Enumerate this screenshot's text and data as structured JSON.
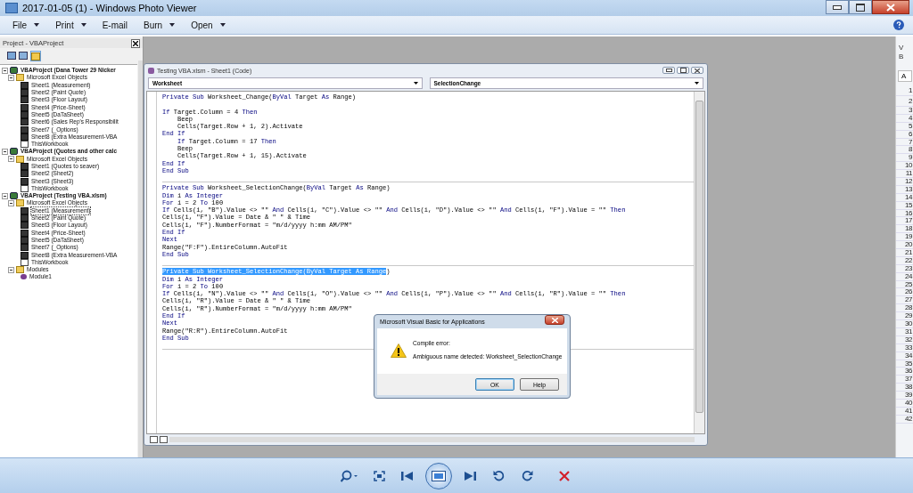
{
  "window": {
    "title": "2017-01-05 (1) - Windows Photo Viewer"
  },
  "menu": [
    {
      "label": "File",
      "dropdown": true
    },
    {
      "label": "Print",
      "dropdown": true
    },
    {
      "label": "E-mail",
      "dropdown": false
    },
    {
      "label": "Burn",
      "dropdown": true
    },
    {
      "label": "Open",
      "dropdown": true
    }
  ],
  "project_panel": {
    "title": "Project - VBAProject",
    "tree": [
      {
        "label": "VBAProject (Dana Tower 29 Nicker",
        "kind": "project",
        "expanded": true,
        "selected": false,
        "children": [
          {
            "label": "Microsoft Excel Objects",
            "kind": "folder",
            "expanded": true,
            "selected": false,
            "children": [
              {
                "label": "Sheet1 (Measurement)",
                "kind": "sheet",
                "selected": false
              },
              {
                "label": "Sheet2 (Paint Quote)",
                "kind": "sheet",
                "selected": false
              },
              {
                "label": "Sheet3 (Floor Layout)",
                "kind": "sheet",
                "selected": false
              },
              {
                "label": "Sheet4 (Price-Sheet)",
                "kind": "sheet",
                "selected": false
              },
              {
                "label": "Sheet5 (DaTaSheet)",
                "kind": "sheet",
                "selected": false
              },
              {
                "label": "Sheet6 (Sales Rep's Responsibilit",
                "kind": "sheet",
                "selected": false
              },
              {
                "label": "Sheet7 (_Options)",
                "kind": "sheet",
                "selected": false
              },
              {
                "label": "Sheet8 (Extra Measurement-VBA",
                "kind": "sheet",
                "selected": false
              },
              {
                "label": "ThisWorkbook",
                "kind": "workbook",
                "selected": false
              }
            ]
          }
        ]
      },
      {
        "label": "VBAProject (Quotes and other calc",
        "kind": "project",
        "expanded": true,
        "selected": false,
        "children": [
          {
            "label": "Microsoft Excel Objects",
            "kind": "folder",
            "expanded": true,
            "selected": false,
            "children": [
              {
                "label": "Sheet1 (Quotes to seaver)",
                "kind": "sheet",
                "selected": false
              },
              {
                "label": "Sheet2 (Sheet2)",
                "kind": "sheet",
                "selected": false
              },
              {
                "label": "Sheet3 (Sheet3)",
                "kind": "sheet",
                "selected": false
              },
              {
                "label": "ThisWorkbook",
                "kind": "workbook",
                "selected": false
              }
            ]
          }
        ]
      },
      {
        "label": "VBAProject (Testing VBA.xlsm)",
        "kind": "project",
        "expanded": true,
        "selected": false,
        "children": [
          {
            "label": "Microsoft Excel Objects",
            "kind": "folder",
            "expanded": true,
            "selected": false,
            "children": [
              {
                "label": "Sheet1 (Measurement)",
                "kind": "sheet",
                "selected": true
              },
              {
                "label": "Sheet2 (Paint Quote)",
                "kind": "sheet",
                "selected": false
              },
              {
                "label": "Sheet3 (Floor Layout)",
                "kind": "sheet",
                "selected": false
              },
              {
                "label": "Sheet4 (Price-Sheet)",
                "kind": "sheet",
                "selected": false
              },
              {
                "label": "Sheet5 (DaTaSheet)",
                "kind": "sheet",
                "selected": false
              },
              {
                "label": "Sheet7 (_Options)",
                "kind": "sheet",
                "selected": false
              },
              {
                "label": "Sheet8 (Extra Measurement-VBA",
                "kind": "sheet",
                "selected": false
              },
              {
                "label": "ThisWorkbook",
                "kind": "workbook",
                "selected": false
              }
            ]
          },
          {
            "label": "Modules",
            "kind": "folder",
            "expanded": true,
            "selected": false,
            "children": [
              {
                "label": "Module1",
                "kind": "module",
                "selected": false
              }
            ]
          }
        ]
      }
    ]
  },
  "code_window": {
    "title": "Testing VBA.xlsm - Sheet1 (Code)",
    "object_dropdown": "Worksheet",
    "procedure_dropdown": "SelectionChange",
    "procedures": [
      [
        {
          "kind": "line",
          "segments": [
            {
              "kind": "keyword",
              "text": "Private Sub"
            },
            {
              "kind": "plain",
              "text": " Worksheet_Change("
            },
            {
              "kind": "keyword",
              "text": "ByVal"
            },
            {
              "kind": "plain",
              "text": " Target "
            },
            {
              "kind": "keyword",
              "text": "As"
            },
            {
              "kind": "plain",
              "text": " Range)"
            }
          ]
        },
        {
          "kind": "spaced",
          "segments": [
            {
              "kind": "keyword",
              "text": "If"
            },
            {
              "kind": "plain",
              "text": " Target.Column = 4 "
            },
            {
              "kind": "keyword",
              "text": "Then"
            }
          ]
        },
        {
          "kind": "indented",
          "segments": [
            {
              "kind": "plain",
              "text": "Beep"
            }
          ]
        },
        {
          "kind": "indented",
          "segments": [
            {
              "kind": "plain",
              "text": "Cells(Target.Row + 1, 2).Activate"
            }
          ]
        },
        {
          "kind": "line",
          "segments": [
            {
              "kind": "keyword",
              "text": "End If"
            }
          ]
        },
        {
          "kind": "indented",
          "segments": [
            {
              "kind": "keyword",
              "text": "If"
            },
            {
              "kind": "plain",
              "text": " Target.Column = 17 "
            },
            {
              "kind": "keyword",
              "text": "Then"
            }
          ]
        },
        {
          "kind": "indented",
          "segments": [
            {
              "kind": "plain",
              "text": "Beep"
            }
          ]
        },
        {
          "kind": "indented",
          "segments": [
            {
              "kind": "plain",
              "text": "Cells(Target.Row + 1, 15).Activate"
            }
          ]
        },
        {
          "kind": "line",
          "segments": [
            {
              "kind": "keyword",
              "text": "End If"
            }
          ]
        },
        {
          "kind": "line",
          "segments": [
            {
              "kind": "keyword",
              "text": "End Sub"
            }
          ]
        }
      ],
      [
        {
          "kind": "line",
          "segments": [
            {
              "kind": "keyword",
              "text": "Private Sub"
            },
            {
              "kind": "plain",
              "text": " Worksheet_SelectionChange("
            },
            {
              "kind": "keyword",
              "text": "ByVal"
            },
            {
              "kind": "plain",
              "text": " Target "
            },
            {
              "kind": "keyword",
              "text": "As"
            },
            {
              "kind": "plain",
              "text": " Range)"
            }
          ]
        },
        {
          "kind": "line",
          "segments": [
            {
              "kind": "keyword",
              "text": "Dim"
            },
            {
              "kind": "plain",
              "text": " i "
            },
            {
              "kind": "keyword",
              "text": "As Integer"
            }
          ]
        },
        {
          "kind": "line",
          "segments": [
            {
              "kind": "keyword",
              "text": "For"
            },
            {
              "kind": "plain",
              "text": " i = 2 "
            },
            {
              "kind": "keyword",
              "text": "To"
            },
            {
              "kind": "plain",
              "text": " 100"
            }
          ]
        },
        {
          "kind": "line",
          "segments": [
            {
              "kind": "keyword",
              "text": "If"
            },
            {
              "kind": "plain",
              "text": " Cells(i, \"B\").Value <> \"\" "
            },
            {
              "kind": "keyword",
              "text": "And"
            },
            {
              "kind": "plain",
              "text": " Cells(i, \"C\").Value <> \"\" "
            },
            {
              "kind": "keyword",
              "text": "And"
            },
            {
              "kind": "plain",
              "text": " Cells(i, \"D\").Value <> \"\" "
            },
            {
              "kind": "keyword",
              "text": "And"
            },
            {
              "kind": "plain",
              "text": " Cells(i, \"F\").Value = \"\" "
            },
            {
              "kind": "keyword",
              "text": "Then"
            }
          ]
        },
        {
          "kind": "line",
          "segments": [
            {
              "kind": "plain",
              "text": "Cells(i, \"F\").Value = Date & \" \" & Time"
            }
          ]
        },
        {
          "kind": "line",
          "segments": [
            {
              "kind": "plain",
              "text": "Cells(i, \"F\").NumberFormat = \"m/d/yyyy h:mm AM/PM\""
            }
          ]
        },
        {
          "kind": "line",
          "segments": [
            {
              "kind": "keyword",
              "text": "End If"
            }
          ]
        },
        {
          "kind": "line",
          "segments": [
            {
              "kind": "keyword",
              "text": "Next"
            }
          ]
        },
        {
          "kind": "line",
          "segments": [
            {
              "kind": "plain",
              "text": "Range(\"F:F\").EntireColumn.AutoFit"
            }
          ]
        },
        {
          "kind": "line",
          "segments": [
            {
              "kind": "keyword",
              "text": "End Sub"
            }
          ]
        }
      ],
      [
        {
          "kind": "line",
          "segments": [
            {
              "kind": "selected",
              "text": "Private Sub Worksheet_SelectionChange(ByVal Target As Range"
            },
            {
              "kind": "plain",
              "text": ")"
            }
          ]
        },
        {
          "kind": "line",
          "segments": [
            {
              "kind": "keyword",
              "text": "Dim"
            },
            {
              "kind": "plain",
              "text": " i "
            },
            {
              "kind": "keyword",
              "text": "As Integer"
            }
          ]
        },
        {
          "kind": "line",
          "segments": [
            {
              "kind": "keyword",
              "text": "For"
            },
            {
              "kind": "plain",
              "text": " i = 2 "
            },
            {
              "kind": "keyword",
              "text": "To"
            },
            {
              "kind": "plain",
              "text": " 100"
            }
          ]
        },
        {
          "kind": "line",
          "segments": [
            {
              "kind": "keyword",
              "text": "If"
            },
            {
              "kind": "plain",
              "text": " Cells(i, \"N\").Value <> \"\" "
            },
            {
              "kind": "keyword",
              "text": "And"
            },
            {
              "kind": "plain",
              "text": " Cells(i, \"O\").Value <> \"\" "
            },
            {
              "kind": "keyword",
              "text": "And"
            },
            {
              "kind": "plain",
              "text": " Cells(i, \"P\").Value <> \"\" "
            },
            {
              "kind": "keyword",
              "text": "And"
            },
            {
              "kind": "plain",
              "text": " Cells(i, \"R\").Value = \"\" "
            },
            {
              "kind": "keyword",
              "text": "Then"
            }
          ]
        },
        {
          "kind": "line",
          "segments": [
            {
              "kind": "plain",
              "text": "Cells(i, \"R\").Value = Date & \" \" & Time"
            }
          ]
        },
        {
          "kind": "line",
          "segments": [
            {
              "kind": "plain",
              "text": "Cells(i, \"R\").NumberFormat = \"m/d/yyyy h:mm AM/PM\""
            }
          ]
        },
        {
          "kind": "line",
          "segments": [
            {
              "kind": "keyword",
              "text": "End If"
            }
          ]
        },
        {
          "kind": "line",
          "segments": [
            {
              "kind": "keyword",
              "text": "Next"
            }
          ]
        },
        {
          "kind": "line",
          "segments": [
            {
              "kind": "plain",
              "text": "Range(\"R:R\").EntireColumn.AutoFit"
            }
          ]
        },
        {
          "kind": "line",
          "segments": [
            {
              "kind": "keyword",
              "text": "End Sub"
            }
          ]
        }
      ]
    ]
  },
  "dialog": {
    "title": "Microsoft Visual Basic for Applications",
    "heading": "Compile error:",
    "message": "Ambiguous name detected: Worksheet_SelectionChange",
    "buttons": [
      {
        "label": "OK",
        "selected": true
      },
      {
        "label": "Help",
        "selected": false
      }
    ]
  },
  "excel_strip": {
    "ribbon_texts": [
      "V",
      "B"
    ],
    "name_box": "A",
    "row_numbers": [
      "1",
      "2",
      "3",
      "4",
      "5",
      "6",
      "7",
      "8",
      "9",
      "10",
      "11",
      "12",
      "13",
      "14",
      "15",
      "16",
      "17",
      "18",
      "19",
      "20",
      "21",
      "22",
      "23",
      "24",
      "25",
      "26",
      "27",
      "28",
      "29",
      "30",
      "31",
      "32",
      "33",
      "34",
      "35",
      "36",
      "37",
      "38",
      "39",
      "40",
      "41",
      "42"
    ]
  }
}
